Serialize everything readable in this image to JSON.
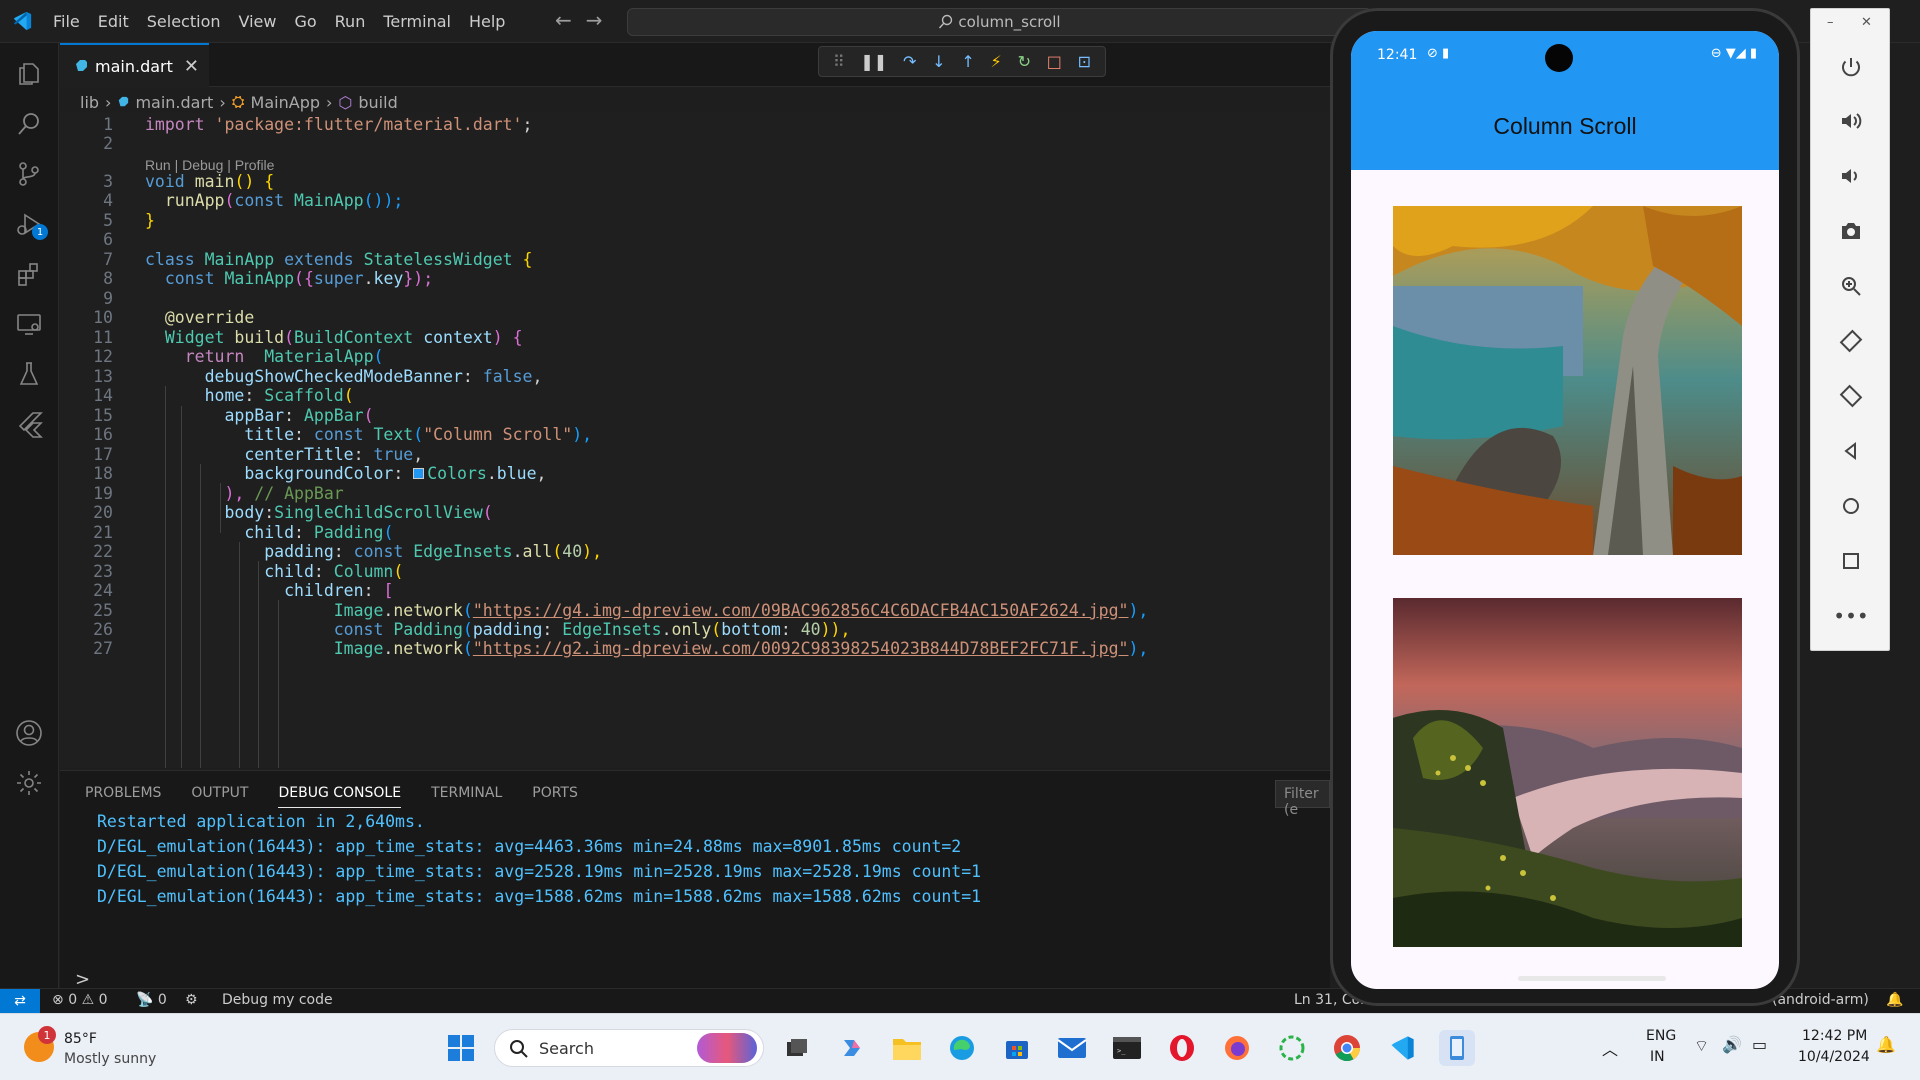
{
  "titlebar": {
    "menu": [
      "File",
      "Edit",
      "Selection",
      "View",
      "Go",
      "Run",
      "Terminal",
      "Help"
    ],
    "search_text": "column_scroll"
  },
  "activity_badge": "1",
  "tab": {
    "label": "main.dart"
  },
  "breadcrumb": {
    "folder": "lib",
    "file": "main.dart",
    "class": "MainApp",
    "method": "build"
  },
  "codelens": "Run | Debug | Profile",
  "code": {
    "line_numbers": [
      "1",
      "2",
      "3",
      "4",
      "5",
      "6",
      "7",
      "8",
      "9",
      "10",
      "11",
      "12",
      "13",
      "14",
      "15",
      "16",
      "17",
      "18",
      "19",
      "20",
      "21",
      "22",
      "23",
      "24",
      "25",
      "26",
      "27"
    ],
    "l1": {
      "kw": "import",
      "str": "'package:flutter/material.dart'",
      "end": ";"
    },
    "l3": {
      "kw": "void",
      "fn": "main",
      "rest": "() {"
    },
    "l4": {
      "fn": "runApp",
      "kw": "const",
      "cls": "MainApp",
      "end": "());"
    },
    "l5": "}",
    "l7": {
      "kw": "class",
      "cls": "MainApp",
      "kw2": "extends",
      "cls2": "StatelessWidget",
      "end": "{"
    },
    "l8": {
      "kw": "const",
      "cls": "MainApp",
      "p1": "({",
      "kw2": "super",
      "p2": ".",
      "prop": "key",
      "end": "});"
    },
    "l10": "@override",
    "l11": {
      "cls": "Widget",
      "fn": "build",
      "p1": "(",
      "cls2": "BuildContext",
      "prop": "context",
      "end": ") {"
    },
    "l12": {
      "kw": "return",
      "cls": "MaterialApp",
      "end": "("
    },
    "l13": {
      "prop": "debugShowCheckedModeBanner",
      "p": ": ",
      "kw": "false",
      "end": ","
    },
    "l14": {
      "prop": "home",
      "p": ": ",
      "cls": "Scaffold",
      "end": "("
    },
    "l15": {
      "prop": "appBar",
      "p": ": ",
      "cls": "AppBar",
      "end": "("
    },
    "l16": {
      "prop": "title",
      "p": ": ",
      "kw": "const",
      "cls": "Text",
      "str": "\"Column Scroll\"",
      "end": "),"
    },
    "l17": {
      "prop": "centerTitle",
      "p": ": ",
      "kw": "true",
      "end": ","
    },
    "l18": {
      "prop": "backgroundColor",
      "p": ": ",
      "cls": "Colors",
      "p2": ".",
      "prop2": "blue",
      "end": ","
    },
    "l19": {
      "p": "), ",
      "cmt": "// AppBar"
    },
    "l20": {
      "prop": "body",
      "p": ":",
      "cls": "SingleChildScrollView",
      "end": "("
    },
    "l21": {
      "prop": "child",
      "p": ": ",
      "cls": "Padding",
      "end": "("
    },
    "l22": {
      "prop": "padding",
      "p": ": ",
      "kw": "const",
      "cls": "EdgeInsets",
      "p2": ".",
      "fn": "all",
      "num": "40",
      "end": "),"
    },
    "l23": {
      "prop": "child",
      "p": ": ",
      "cls": "Column",
      "end": "("
    },
    "l24": {
      "prop": "children",
      "p": ": ",
      "end": "["
    },
    "l25": {
      "cls": "Image",
      "p": ".",
      "fn": "network",
      "str": "\"https://g4.img-dpreview.com/09BAC962856C4C6DACFB4AC150AF2624.jpg\"",
      "end": "),"
    },
    "l26": {
      "kw": "const",
      "cls": "Padding",
      "prop": "padding",
      "p": ": ",
      "cls2": "EdgeInsets",
      "p2": ".",
      "fn": "only",
      "prop2": "bottom",
      "num": "40",
      "end": ")),"
    },
    "l27": {
      "cls": "Image",
      "p": ".",
      "fn": "network",
      "str": "\"https://g2.img-dpreview.com/0092C98398254023B844D78BEF2FC71F.jpg\"",
      "end": "),"
    }
  },
  "panel": {
    "tabs": [
      "PROBLEMS",
      "OUTPUT",
      "DEBUG CONSOLE",
      "TERMINAL",
      "PORTS"
    ],
    "active_tab": "DEBUG CONSOLE",
    "filter_placeholder": "Filter (e",
    "console": [
      "Restarted application in 2,640ms.",
      "D/EGL_emulation(16443): app_time_stats: avg=4463.36ms min=24.88ms max=8901.85ms count=2",
      "D/EGL_emulation(16443): app_time_stats: avg=2528.19ms min=2528.19ms max=2528.19ms count=1",
      "D/EGL_emulation(16443): app_time_stats: avg=1588.62ms min=1588.62ms max=1588.62ms count=1"
    ],
    "prompt": ">"
  },
  "statusbar": {
    "errors": "0",
    "warnings": "0",
    "ports": "0",
    "debug": "Debug my code",
    "position": "Ln 31, Col",
    "device": "(android-arm)"
  },
  "taskbar": {
    "weather_temp": "85°F",
    "weather_desc": "Mostly sunny",
    "weather_badge": "1",
    "search": "Search",
    "lang1": "ENG",
    "lang2": "IN",
    "time": "12:42 PM",
    "date": "10/4/2024"
  },
  "phone": {
    "time": "12:41",
    "app_title": "Column Scroll"
  },
  "colors": {
    "accent": "#0078d4",
    "app_bar": "#2196f3",
    "console": "#4fc1ff"
  }
}
